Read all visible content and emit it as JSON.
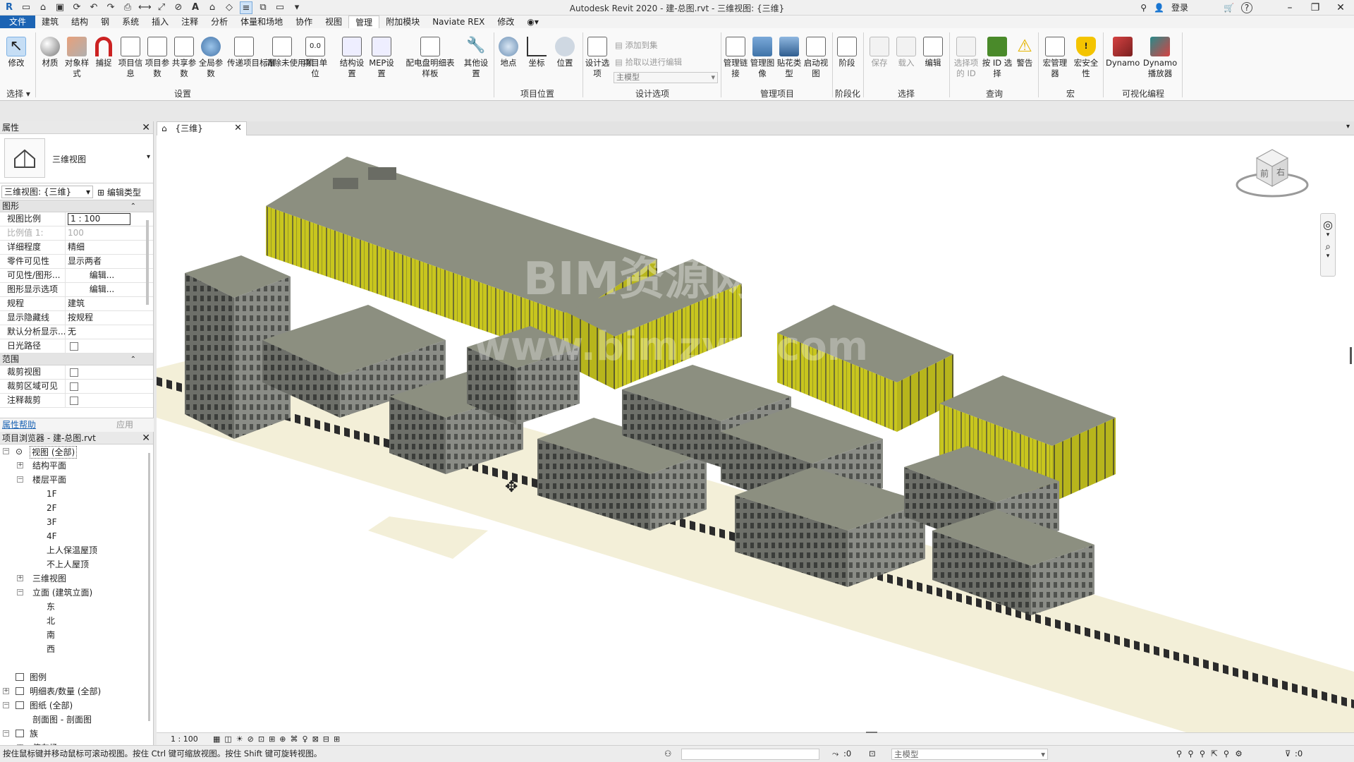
{
  "app": {
    "title": "Autodesk Revit 2020 - 建-总图.rvt - 三维视图: {三维}",
    "login_label": "登录",
    "help_label": "?"
  },
  "ribbon": {
    "tabs": [
      "文件",
      "建筑",
      "结构",
      "钢",
      "系统",
      "插入",
      "注释",
      "分析",
      "体量和场地",
      "协作",
      "视图",
      "管理",
      "附加模块",
      "Naviate REX",
      "修改"
    ],
    "active_tab": "管理",
    "buttons": {
      "modify": "修改",
      "materials": "材质",
      "object_styles": "对象样式",
      "snaps": "捕捉",
      "project_info": "项目信息",
      "project_params": "项目参数",
      "shared_params": "共享参数",
      "global_params": "全局参数",
      "transfer_standards": "传递项目标准",
      "purge_unused": "清除未使用项",
      "project_units": "项目单位",
      "structural_settings": "结构设置",
      "mep_settings": "MEP设置",
      "panel_schedule_templates": "配电盘明细表样板",
      "additional_settings": "其他设置",
      "location": "地点",
      "coordinates": "坐标",
      "position": "位置",
      "design_options": "设计选项",
      "add_to_set": "添加到集",
      "pick_to_edit": "拾取以进行编辑",
      "main_model": "主模型",
      "manage_links": "管理链接",
      "manage_images": "管理图像",
      "decal_types": "贴花类型",
      "starting_view": "启动视图",
      "phases": "阶段",
      "save": "保存",
      "load": "载入",
      "edit": "编辑",
      "ids_of_selection": "选择项的 ID",
      "select_by_id": "按 ID 选择",
      "warnings": "警告",
      "macro_manager": "宏管理器",
      "macro_security": "宏安全性",
      "dynamo": "Dynamo",
      "dynamo_player": "Dynamo 播放器"
    },
    "panels": {
      "select": "选择",
      "settings": "设置",
      "project_location": "项目位置",
      "design_options": "设计选项",
      "manage_project": "管理项目",
      "phasing": "阶段化",
      "selection": "选择",
      "inquiry": "查询",
      "macros": "宏",
      "visual_programming": "可视化编程"
    }
  },
  "properties": {
    "title": "属性",
    "type_name": "三维视图",
    "instance_selector": "三维视图: {三维}",
    "edit_type": "编辑类型",
    "groups": {
      "graphics": "图形",
      "extents": "范围"
    },
    "rows": {
      "view_scale": {
        "k": "视图比例",
        "v": "1 : 100"
      },
      "scale_value": {
        "k": "比例值 1:",
        "v": "100"
      },
      "detail_level": {
        "k": "详细程度",
        "v": "精细"
      },
      "parts_visibility": {
        "k": "零件可见性",
        "v": "显示两者"
      },
      "vg_overrides": {
        "k": "可见性/图形...",
        "v": "编辑..."
      },
      "graphic_display": {
        "k": "图形显示选项",
        "v": "编辑..."
      },
      "discipline": {
        "k": "规程",
        "v": "建筑"
      },
      "hidden_lines": {
        "k": "显示隐藏线",
        "v": "按规程"
      },
      "analysis_display": {
        "k": "默认分析显示...",
        "v": "无"
      },
      "sun_path": {
        "k": "日光路径"
      },
      "crop_view": {
        "k": "裁剪视图"
      },
      "crop_visible": {
        "k": "裁剪区域可见"
      },
      "annotation_crop": {
        "k": "注释裁剪"
      }
    },
    "help_link": "属性帮助",
    "apply": "应用"
  },
  "browser": {
    "title": "项目浏览器 - 建-总图.rvt",
    "items": {
      "views": "视图 (全部)",
      "structural_plans": "结构平面",
      "floor_plans": "楼层平面",
      "f1": "1F",
      "f2": "2F",
      "f3": "3F",
      "f4": "4F",
      "roof_occupied": "上人保温屋顶",
      "roof_unoccupied": "不上人屋顶",
      "views_3d": "三维视图",
      "elevations": "立面 (建筑立面)",
      "east": "东",
      "north": "北",
      "south": "南",
      "west": "西",
      "legends": "图例",
      "schedules": "明细表/数量 (全部)",
      "sheets": "图纸 (全部)",
      "sheet_section": "剖面图 - 剖面图",
      "families": "族",
      "parking": "停车场"
    }
  },
  "view": {
    "tab_label": "{三维}",
    "watermark": "BIM资源网",
    "watermark_url": "www.bimzyw.com",
    "viewcube_front": "前",
    "viewcube_right": "右",
    "scale": "1 : 100"
  },
  "status": {
    "hint": "按住鼠标键并移动鼠标可滚动视图。按住 Ctrl 键可缩放视图。按住 Shift 键可旋转视图。",
    "count_a": ":0",
    "model": "主模型",
    "filter_count": ":0"
  },
  "colors": {
    "accent": "#1c64b4",
    "curtain_wall": "#c8c61e",
    "roof": "#8c8f80",
    "road": "#f3efd8"
  }
}
